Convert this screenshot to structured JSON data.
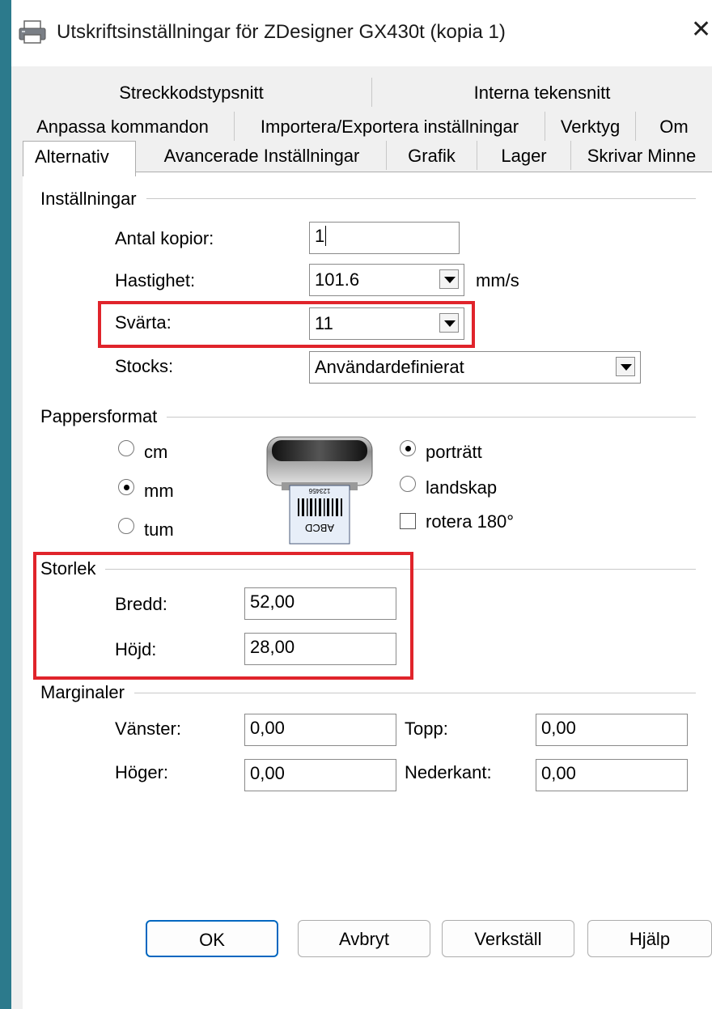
{
  "window": {
    "title": "Utskriftsinställningar för ZDesigner GX430t (kopia 1)",
    "icon": "printer-icon",
    "close_label": "✕"
  },
  "tabs": {
    "row1": [
      "Streckkodstypsnitt",
      "Interna tekensnitt"
    ],
    "row2": [
      "Anpassa kommandon",
      "Importera/Exportera inställningar",
      "Verktyg",
      "Om"
    ],
    "row3": [
      "Alternativ",
      "Avancerade Inställningar",
      "Grafik",
      "Lager",
      "Skrivar Minne"
    ],
    "active": "Alternativ"
  },
  "settings": {
    "section_label": "Inställningar",
    "copies_label": "Antal kopior:",
    "copies_value": "1",
    "speed_label": "Hastighet:",
    "speed_value": "101.6",
    "speed_unit": "mm/s",
    "darkness_label": "Svärta:",
    "darkness_value": "11",
    "stocks_label": "Stocks:",
    "stocks_value": "Användardefinierat"
  },
  "paper": {
    "section_label": "Pappersformat",
    "unit_cm": "cm",
    "unit_mm": "mm",
    "unit_tum": "tum",
    "selected_unit": "mm",
    "label_top_text": "123456",
    "label_bottom_text": "ABCD",
    "orientation_portrait": "porträtt",
    "orientation_landscape": "landskap",
    "selected_orientation": "porträtt",
    "rotate_label": "rotera 180°",
    "rotate_checked": false
  },
  "size": {
    "section_label": "Storlek",
    "width_label": "Bredd:",
    "width_value": "52,00",
    "height_label": "Höjd:",
    "height_value": "28,00"
  },
  "margins": {
    "section_label": "Marginaler",
    "left_label": "Vänster:",
    "left_value": "0,00",
    "top_label": "Topp:",
    "top_value": "0,00",
    "right_label": "Höger:",
    "right_value": "0,00",
    "bottom_label": "Nederkant:",
    "bottom_value": "0,00"
  },
  "buttons": {
    "ok": "OK",
    "cancel": "Avbryt",
    "apply": "Verkställ",
    "help": "Hjälp"
  },
  "colors": {
    "desktop": "#2c7a8c",
    "highlight": "#e0242b",
    "default_button_border": "#0067c0"
  }
}
